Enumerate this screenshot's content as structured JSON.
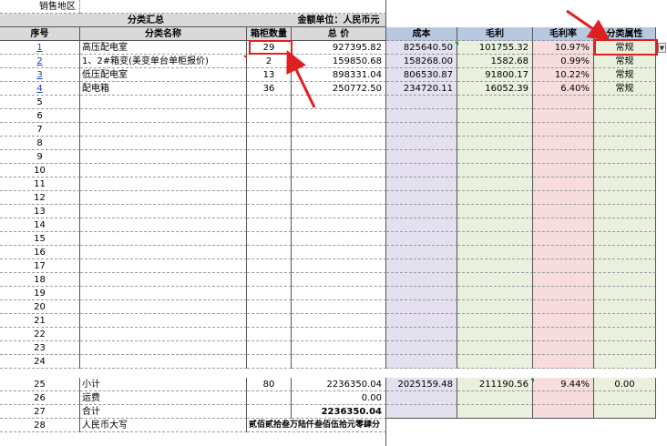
{
  "region": {
    "label": "销售地区",
    "value": ""
  },
  "summary": {
    "title": "分类汇总",
    "unit": "金额单位：人民币元"
  },
  "headers": {
    "index": "序号",
    "name": "分类名称",
    "boxes": "箱柜数量",
    "total": "总     价",
    "cost": "成本",
    "gross_profit": "毛利",
    "gross_margin": "毛利率",
    "attribute": "分类属性"
  },
  "items": [
    {
      "index": "1",
      "name": "高压配电室",
      "boxes": "29",
      "total": "927395.82",
      "cost": "825640.50",
      "gross_profit": "101755.32",
      "gross_margin": "10.97%",
      "attribute": "常规"
    },
    {
      "index": "2",
      "name": "1、2#箱变(美变单台单柜报价)",
      "boxes": "2",
      "total": "159850.68",
      "cost": "158268.00",
      "gross_profit": "1582.68",
      "gross_margin": "0.99%",
      "attribute": "常规"
    },
    {
      "index": "3",
      "name": "低压配电室",
      "boxes": "13",
      "total": "898331.04",
      "cost": "806530.87",
      "gross_profit": "91800.17",
      "gross_margin": "10.22%",
      "attribute": "常规"
    },
    {
      "index": "4",
      "name": "配电箱",
      "boxes": "36",
      "total": "250772.50",
      "cost": "234720.11",
      "gross_profit": "16052.39",
      "gross_margin": "6.40%",
      "attribute": "常规"
    }
  ],
  "empty_rows": [
    "5",
    "6",
    "7",
    "8",
    "9",
    "10",
    "11",
    "12",
    "13",
    "14",
    "15",
    "16",
    "17",
    "18",
    "19",
    "20",
    "21",
    "22",
    "23",
    "24"
  ],
  "subtotal": {
    "index": "25",
    "label": "小计",
    "boxes": "80",
    "total": "2236350.04",
    "cost": "2025159.48",
    "gross_profit": "211190.56",
    "gross_margin": "9.44%",
    "attribute": "0.00"
  },
  "freight": {
    "index": "26",
    "label": "运费",
    "total": "0.00"
  },
  "grand_total": {
    "index": "27",
    "label": "合计",
    "total": "2236350.04"
  },
  "uppercase": {
    "index": "28",
    "label": "人民币大写",
    "value": "贰佰贰拾叁万陆仟叁佰伍拾元零肆分"
  },
  "dropdown_icon": "chevron-down-icon",
  "colors": {
    "header_gray": "#d9d9d9",
    "cost_purple": "#e4e0f0",
    "profit_green": "#e9f0dd",
    "margin_pink": "#f6dcdc",
    "link_blue": "#1f3fbf",
    "highlight_red": "#e02020"
  }
}
